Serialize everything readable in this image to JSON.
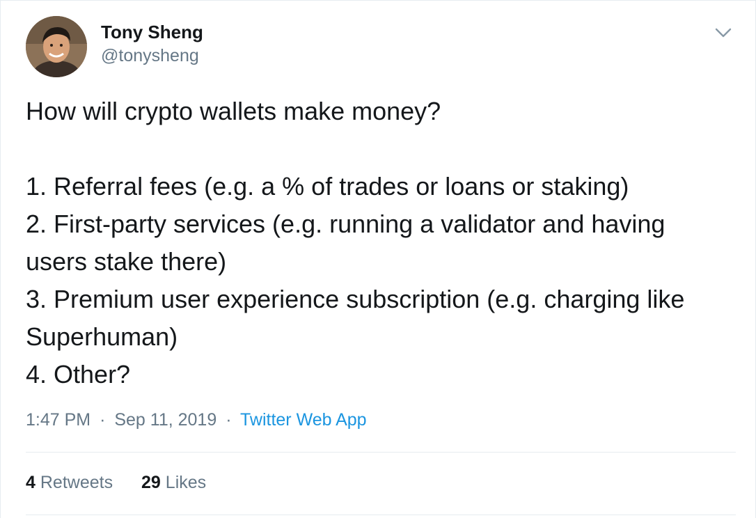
{
  "author": {
    "display_name": "Tony Sheng",
    "handle": "@tonysheng",
    "avatar_icon": "profile-photo"
  },
  "menu": {
    "icon": "chevron-down-icon"
  },
  "tweet": {
    "text": "How will crypto wallets make money?\n\n1. Referral fees (e.g. a % of trades or loans or staking)\n2. First-party services (e.g. running a validator and having users stake there)\n3. Premium user experience subscription (e.g. charging like Superhuman)\n4. Other?"
  },
  "meta": {
    "time": "1:47 PM",
    "separator": "·",
    "date": "Sep 11, 2019",
    "source": "Twitter Web App"
  },
  "stats": {
    "retweets_count": "4",
    "retweets_label": "Retweets",
    "likes_count": "29",
    "likes_label": "Likes"
  },
  "colors": {
    "text": "#14171a",
    "secondary": "#657786",
    "link": "#1b95e0",
    "divider": "#e6ecf0"
  }
}
